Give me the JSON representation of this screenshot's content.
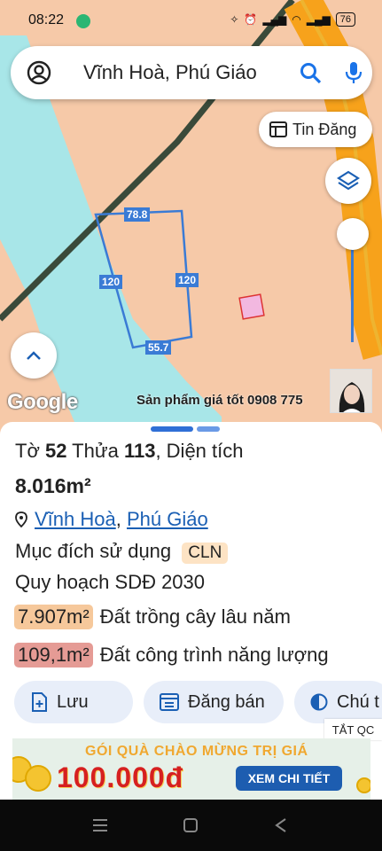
{
  "status": {
    "time": "08:22",
    "battery": "76"
  },
  "search": {
    "text": "Vĩnh Hoà, Phú Giáo"
  },
  "tin_dang": {
    "label": "Tin Đăng"
  },
  "map": {
    "labels": [
      "78.8",
      "120",
      "120",
      "55.7"
    ],
    "google": "Google",
    "promo": "Sản phẩm giá tốt 0908 775",
    "colors": {
      "land": "#f6c9a8",
      "river": "#a8e6e8",
      "road": "#f7a21b",
      "plot": "#3a7bd5"
    }
  },
  "sheet": {
    "parcel_prefix": "Tờ ",
    "sheet_no": "52",
    "parcel_mid": " Thửa ",
    "parcel_no": "113",
    "area_label": ", Diện tích",
    "area_value": "8.016m²",
    "ward": "Vĩnh Hoà",
    "sep": ",",
    "district": "Phú Giáo",
    "purpose_label": "Mục đích sử dụng",
    "purpose_code": "CLN",
    "plan_label": "Quy hoạch SDĐ 2030",
    "zones": [
      {
        "area": "7.907m²",
        "desc": "Đất trồng cây lâu năm"
      },
      {
        "area": "109,1m²",
        "desc": "Đất công trình năng lượng"
      }
    ],
    "actions": {
      "save": "Lưu",
      "sell": "Đăng bán",
      "note": "Chú t"
    },
    "ad_tag": "TẮT QC",
    "ad": {
      "line1": "GÓI QUÀ CHÀO MỪNG TRỊ GIÁ",
      "amount": "100.000đ",
      "button": "XEM CHI TIẾT"
    }
  }
}
